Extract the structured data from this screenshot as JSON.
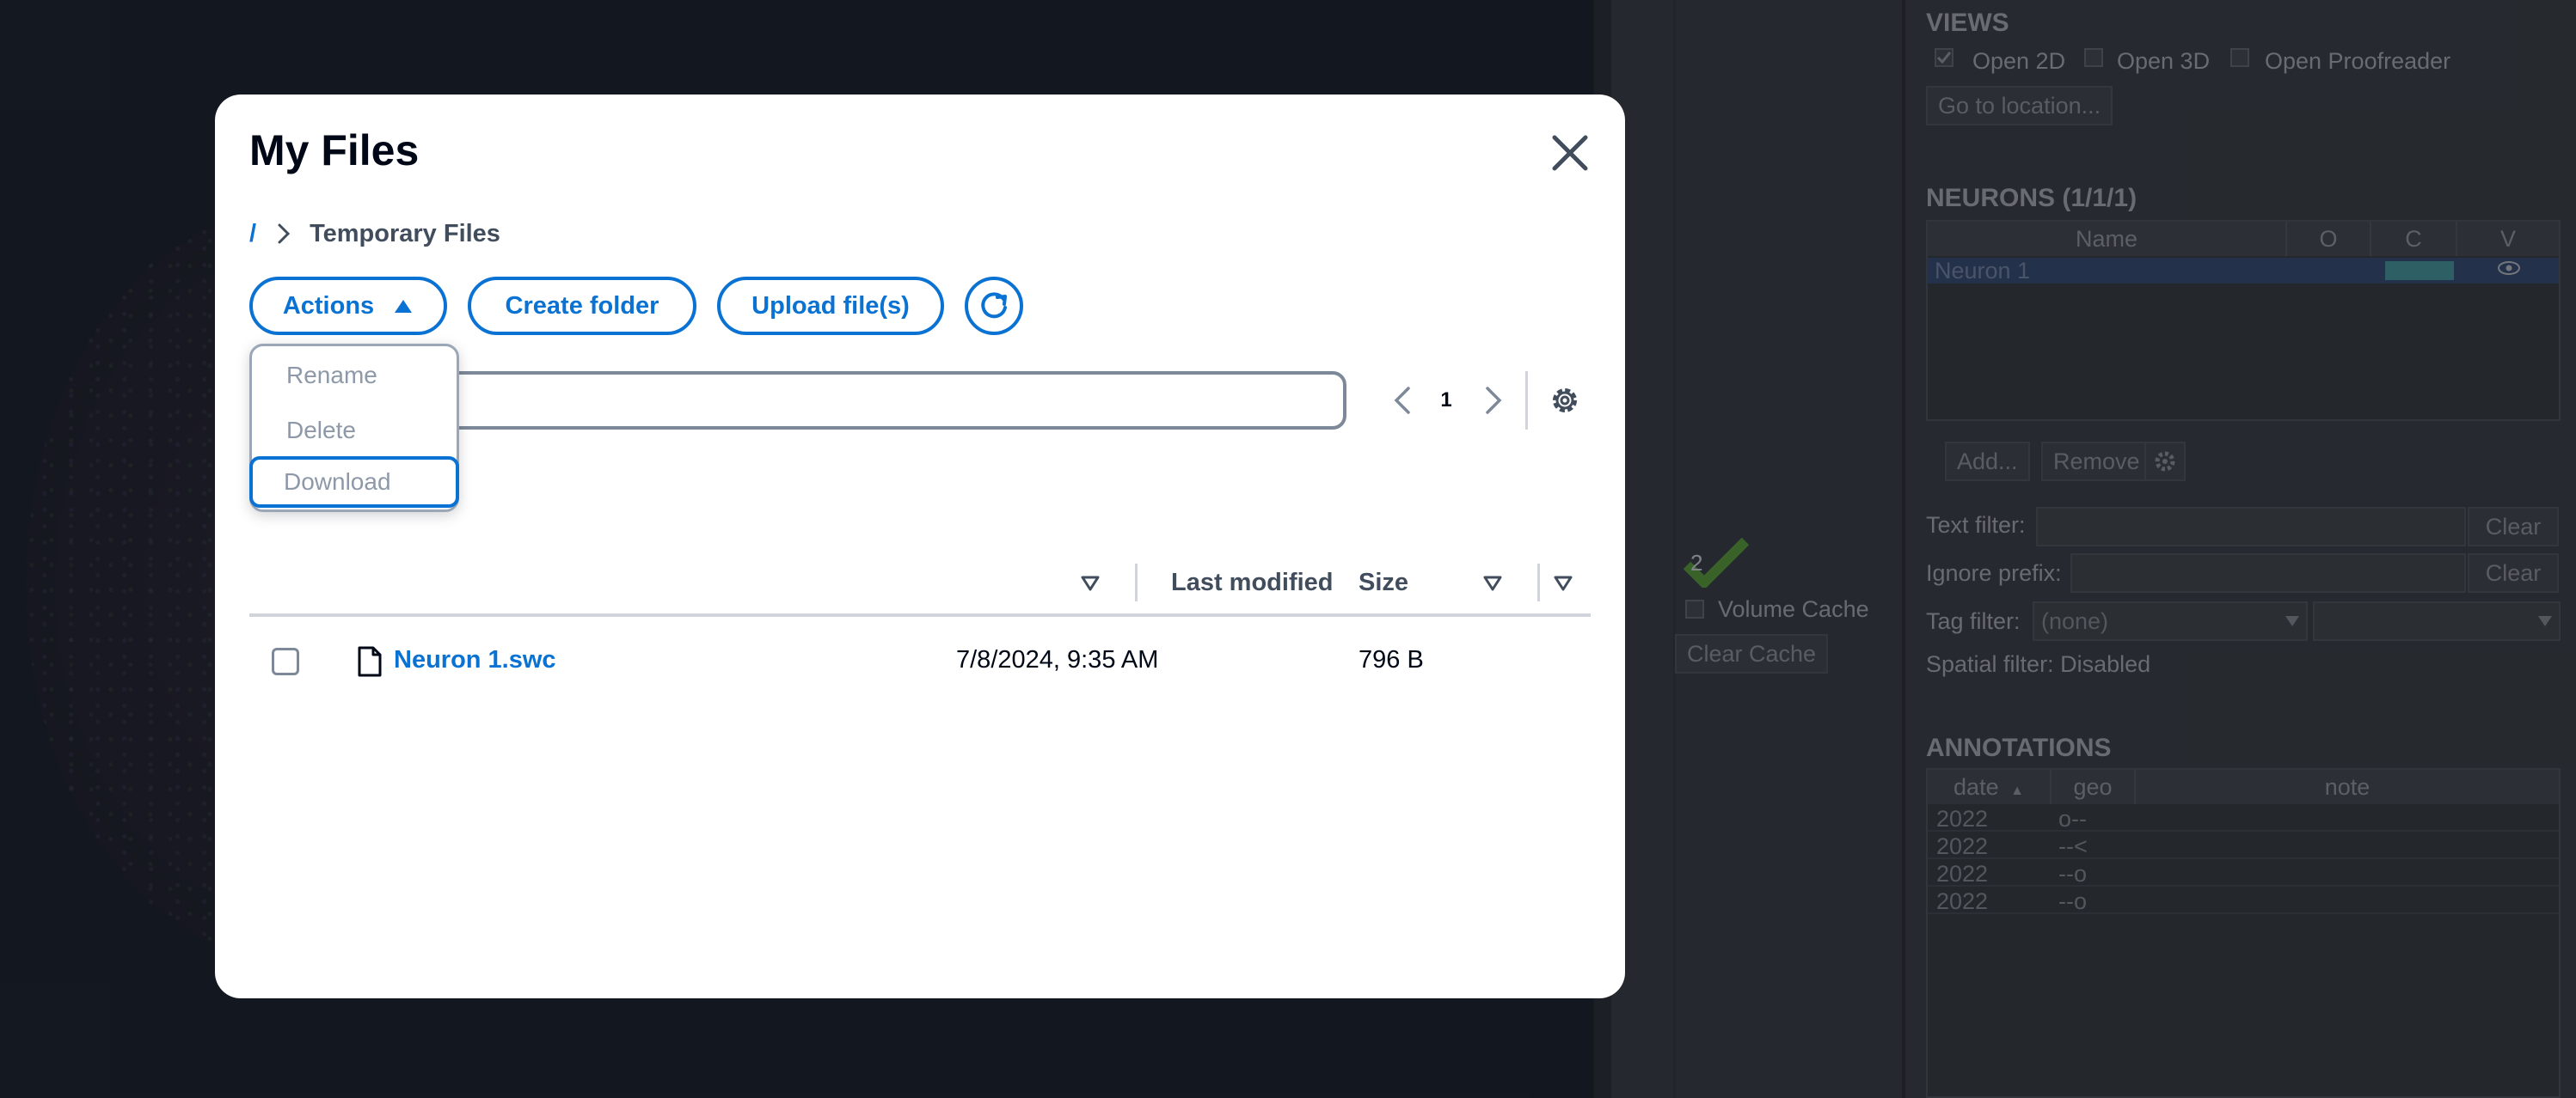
{
  "dialog": {
    "title": "My Files",
    "breadcrumb": {
      "root": "/",
      "current": "Temporary Files"
    },
    "toolbar": {
      "actions_label": "Actions",
      "create_folder_label": "Create folder",
      "upload_label": "Upload file(s)"
    },
    "actions_menu": [
      "Rename",
      "Delete",
      "Download"
    ],
    "search": {
      "value": "",
      "placeholder": ""
    },
    "pagination": {
      "current_page": "1"
    },
    "table": {
      "columns": [
        "Last modified",
        "Size"
      ],
      "rows": [
        {
          "name": "Neuron 1.swc",
          "modified": "7/8/2024, 9:35 AM",
          "size": "796 B"
        }
      ]
    }
  },
  "background_app": {
    "views": {
      "title": "VIEWS",
      "open_2d": "Open 2D",
      "open_3d": "Open 3D",
      "open_proofreader": "Open Proofreader",
      "go_to_location": "Go to location..."
    },
    "neurons": {
      "title": "NEURONS (1/1/1)",
      "columns": [
        "Name",
        "O",
        "C",
        "V"
      ],
      "rows": [
        {
          "name": "Neuron 1"
        }
      ],
      "add": "Add...",
      "remove": "Remove"
    },
    "filters": {
      "text_filter": "Text filter:",
      "ignore_prefix": "Ignore prefix:",
      "tag_filter": "Tag filter:",
      "tag_value": "(none)",
      "clear": "Clear",
      "spatial": "Spatial filter: Disabled"
    },
    "cache": {
      "count": "2",
      "volume_cache": "Volume Cache",
      "clear_cache": "Clear Cache"
    },
    "annotations": {
      "title": "ANNOTATIONS",
      "columns": [
        "date",
        "geo",
        "note"
      ],
      "rows": [
        {
          "date": "2022",
          "geo": "o--"
        },
        {
          "date": "2022",
          "geo": "--<"
        },
        {
          "date": "2022",
          "geo": "--o"
        },
        {
          "date": "2022",
          "geo": "--o"
        }
      ]
    },
    "colors": {
      "selected_row": "#3a4f78",
      "neuron_color": "#4aa3a8",
      "accent": "#0972d3"
    }
  }
}
